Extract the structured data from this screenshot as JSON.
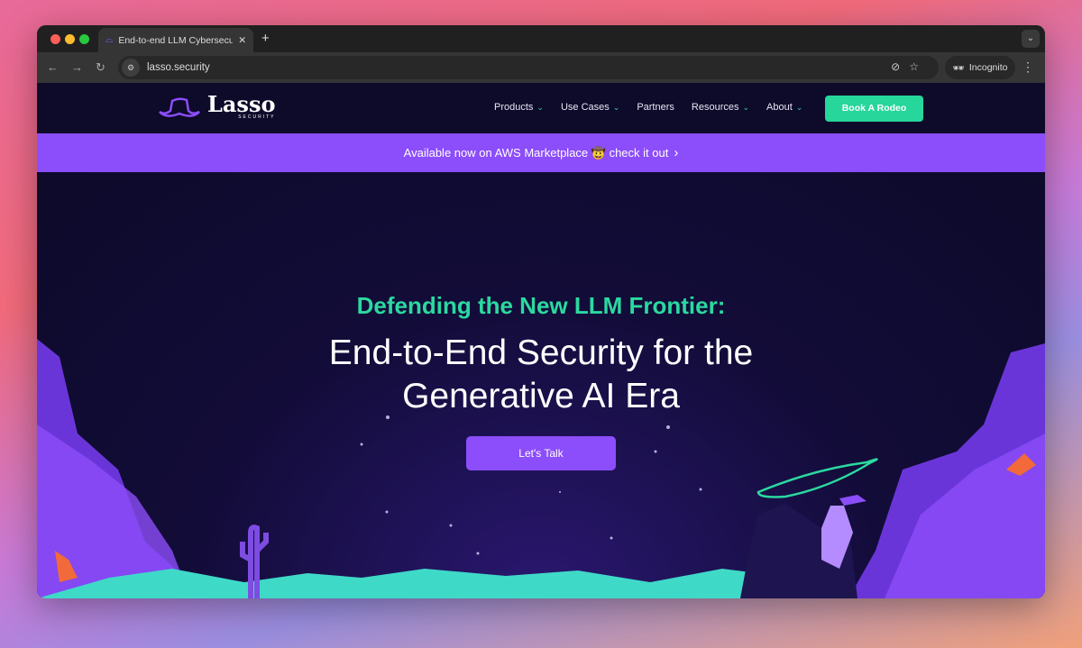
{
  "browser": {
    "tab_title": "End-to-end LLM Cybersecurity",
    "url": "lasso.security",
    "incognito_label": "Incognito"
  },
  "header": {
    "logo_word": "Lasso",
    "logo_sub": "SECURITY",
    "menu": [
      {
        "label": "Products",
        "dropdown": true
      },
      {
        "label": "Use Cases",
        "dropdown": true
      },
      {
        "label": "Partners",
        "dropdown": false
      },
      {
        "label": "Resources",
        "dropdown": true
      },
      {
        "label": "About",
        "dropdown": true
      }
    ],
    "cta": "Book A Rodeo"
  },
  "banner": {
    "text": "Available now on AWS Marketplace 🤠 check it out"
  },
  "hero": {
    "kicker": "Defending the New LLM Frontier:",
    "headline_1": "End-to-End Security for the",
    "headline_2": "Generative AI Era",
    "button": "Let's Talk"
  },
  "colors": {
    "brand_purple": "#8c4dfa",
    "accent_green": "#26d69b",
    "background": "#0d0a2a"
  }
}
